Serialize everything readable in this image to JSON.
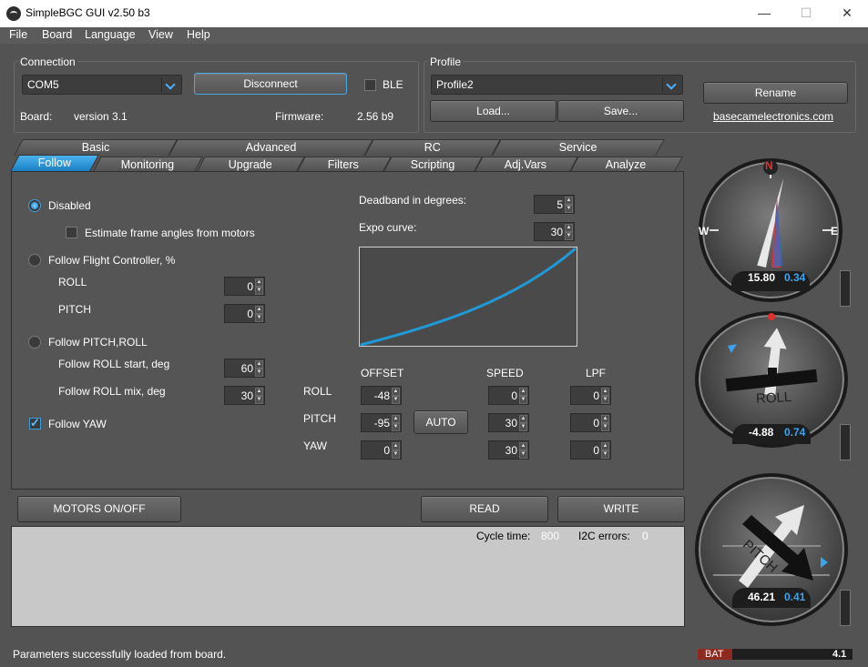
{
  "window": {
    "title": "SimpleBGC GUI v2.50 b3",
    "min": "—",
    "max": "☐",
    "close": "✕"
  },
  "menu": [
    "File",
    "Board",
    "Language",
    "View",
    "Help"
  ],
  "connection": {
    "group_label": "Connection",
    "port": "COM5",
    "disconnect_label": "Disconnect",
    "ble_label": "BLE",
    "board_label": "Board:",
    "board_value": "version 3.1",
    "firmware_label": "Firmware:",
    "firmware_value": "2.56 b9"
  },
  "profile": {
    "group_label": "Profile",
    "selected": "Profile2",
    "load_label": "Load...",
    "save_label": "Save...",
    "rename_label": "Rename",
    "link": "basecamelectronics.com"
  },
  "tabs_top": [
    "Basic",
    "Advanced",
    "RC",
    "Service"
  ],
  "tabs_bottom": [
    "Follow",
    "Monitoring",
    "Upgrade",
    "Filters",
    "Scripting",
    "Adj.Vars",
    "Analyze"
  ],
  "active_tab": "Follow",
  "follow": {
    "disabled_label": "Disabled",
    "estimate_label": "Estimate frame angles from motors",
    "follow_fc_label": "Follow Flight Controller, %",
    "roll_label": "ROLL",
    "roll_value": "0",
    "pitch_label": "PITCH",
    "pitch_value": "0",
    "follow_pr_label": "Follow PITCH,ROLL",
    "roll_start_label": "Follow ROLL start, deg",
    "roll_start_value": "60",
    "roll_mix_label": "Follow ROLL mix, deg",
    "roll_mix_value": "30",
    "follow_yaw_label": "Follow YAW",
    "deadband_label": "Deadband in degrees:",
    "deadband_value": "5",
    "expo_label": "Expo curve:",
    "expo_value": "30",
    "offset_header": "OFFSET",
    "speed_header": "SPEED",
    "lpf_header": "LPF",
    "auto_label": "AUTO",
    "axis_rows": [
      {
        "axis": "ROLL",
        "offset": "-48",
        "speed": "0",
        "lpf": "0"
      },
      {
        "axis": "PITCH",
        "offset": "-95",
        "speed": "30",
        "lpf": "0"
      },
      {
        "axis": "YAW",
        "offset": "0",
        "speed": "30",
        "lpf": "0"
      }
    ]
  },
  "actions": {
    "motors_label": "MOTORS ON/OFF",
    "read_label": "READ",
    "write_label": "WRITE"
  },
  "log": {
    "cycle_label": "Cycle time:",
    "cycle_value": "800",
    "i2c_label": "I2C errors:",
    "i2c_value": "0"
  },
  "instruments": {
    "compass": {
      "n": "N",
      "w": "W",
      "e": "E",
      "value": "15.80",
      "rate": "0.34"
    },
    "roll": {
      "label": "ROLL",
      "value": "-4.88",
      "rate": "0.74"
    },
    "pitch": {
      "label": "PITCH",
      "value": "46.21",
      "rate": "0.41"
    }
  },
  "status": {
    "message": "Parameters successfully loaded from board.",
    "bat_label": "BAT",
    "bat_value": "4.1"
  },
  "colors": {
    "accent": "#2a9ad8",
    "panel": "#535353",
    "curve": "#1f9ad6",
    "bat": "#8d2a20"
  }
}
